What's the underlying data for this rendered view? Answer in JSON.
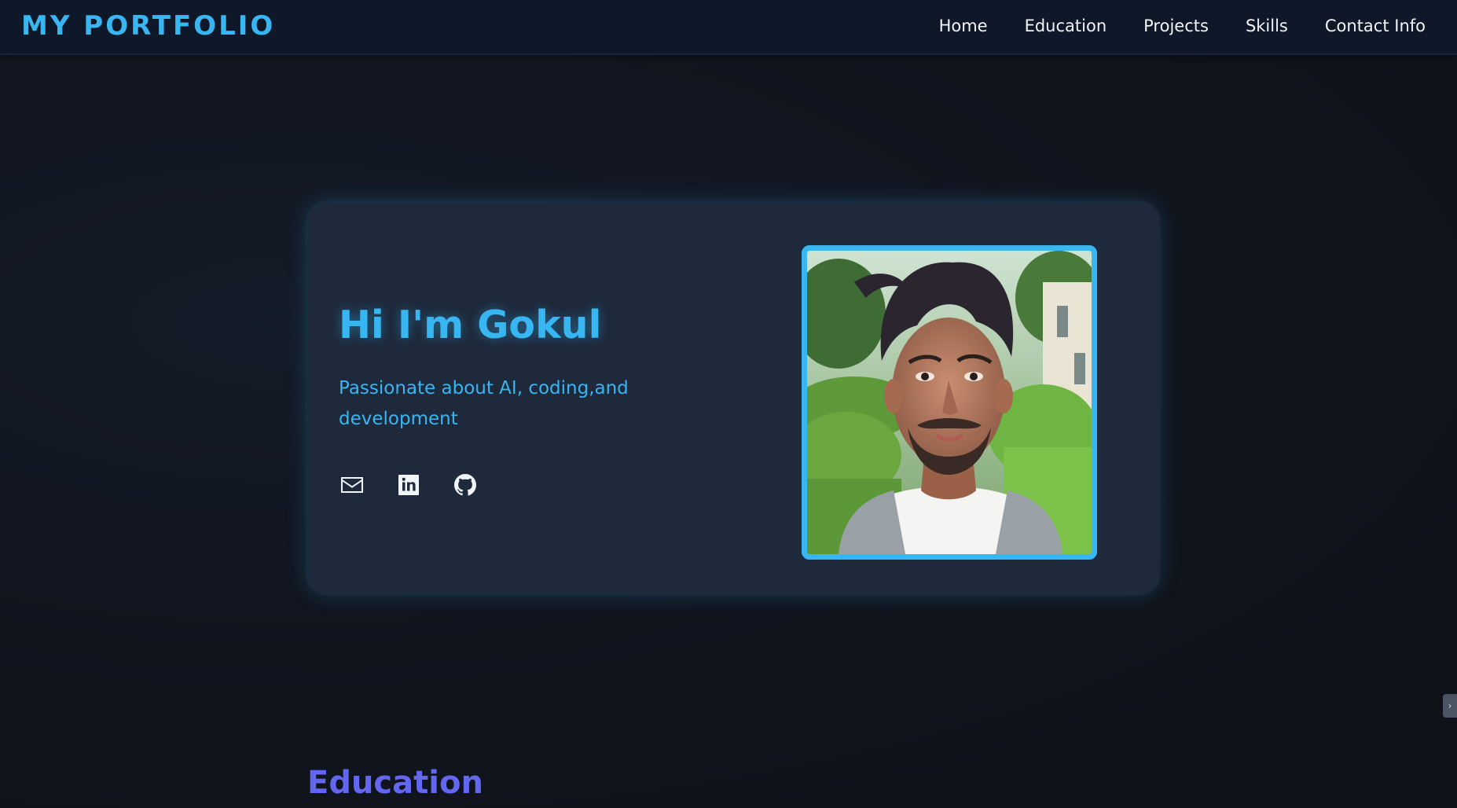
{
  "navbar": {
    "brand": "MY PORTFOLIO",
    "links": [
      "Home",
      "Education",
      "Projects",
      "Skills",
      "Contact Info"
    ]
  },
  "hero": {
    "title": "Hi I'm Gokul",
    "subtitle": "Passionate about AI, coding,and development",
    "social_icons": [
      "envelope-icon",
      "linkedin-icon",
      "github-icon"
    ],
    "photo_alt": "Profile photo"
  },
  "sections": {
    "education_heading": "Education"
  },
  "colors": {
    "accent": "#38b6f2",
    "heading_purple": "#6366f1",
    "card_bg": "#1e293b",
    "nav_bg": "#0f1828",
    "page_bg": "#111520"
  }
}
